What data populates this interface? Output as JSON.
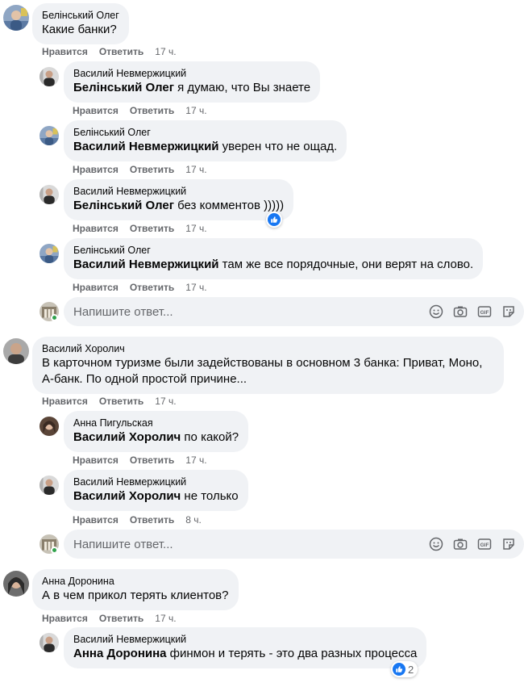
{
  "action_like": "Нравится",
  "action_reply": "Ответить",
  "reply_placeholder": "Напишите ответ...",
  "comments": [
    {
      "author": "Белінський Олег",
      "mention": "",
      "text": "Какие банки?",
      "time": "17 ч."
    },
    {
      "author": "Василий Невмержицкий",
      "mention": "Белінський Олег",
      "text": " я думаю, что Вы знаете",
      "time": "17 ч."
    },
    {
      "author": "Белінський Олег",
      "mention": "Василий Невмержицкий",
      "text": " уверен что не ощад.",
      "time": "17 ч."
    },
    {
      "author": "Василий Невмержицкий",
      "mention": "Белінський Олег",
      "text": " без комментов )))))",
      "time": "17 ч."
    },
    {
      "author": "Белінський Олег",
      "mention": "Василий Невмержицкий",
      "text": " там же все порядочные, они верят на слово.",
      "time": "17 ч."
    },
    {
      "author": "Василий Хоролич",
      "mention": "",
      "text_line1": "В карточном туризме были задействованы в основном 3 банка: Приват, Моно,",
      "text_line2": "А-банк. По одной простой причине...",
      "time": "17 ч."
    },
    {
      "author": "Анна Пигульская",
      "mention": "Василий Хоролич",
      "text": " по какой?",
      "time": "17 ч."
    },
    {
      "author": "Василий Невмержицкий",
      "mention": "Василий Хоролич",
      "text": " не только",
      "time": "8 ч."
    },
    {
      "author": "Анна Доронина",
      "mention": "",
      "text": "А в чем прикол терять клиентов?",
      "time": "17 ч."
    },
    {
      "author": "Василий Невмержицкий",
      "mention": "Анна Доронина",
      "text": " финмон и терять - это два разных процесса",
      "time": ""
    }
  ],
  "reactions": [
    {
      "icon": "like-icon",
      "count": ""
    },
    {
      "icon": "like-icon",
      "count": "2"
    }
  ],
  "colors": {
    "bubble": "#f0f2f5",
    "meta": "#65676b",
    "like": "#1877f2",
    "online": "#31a24c"
  }
}
